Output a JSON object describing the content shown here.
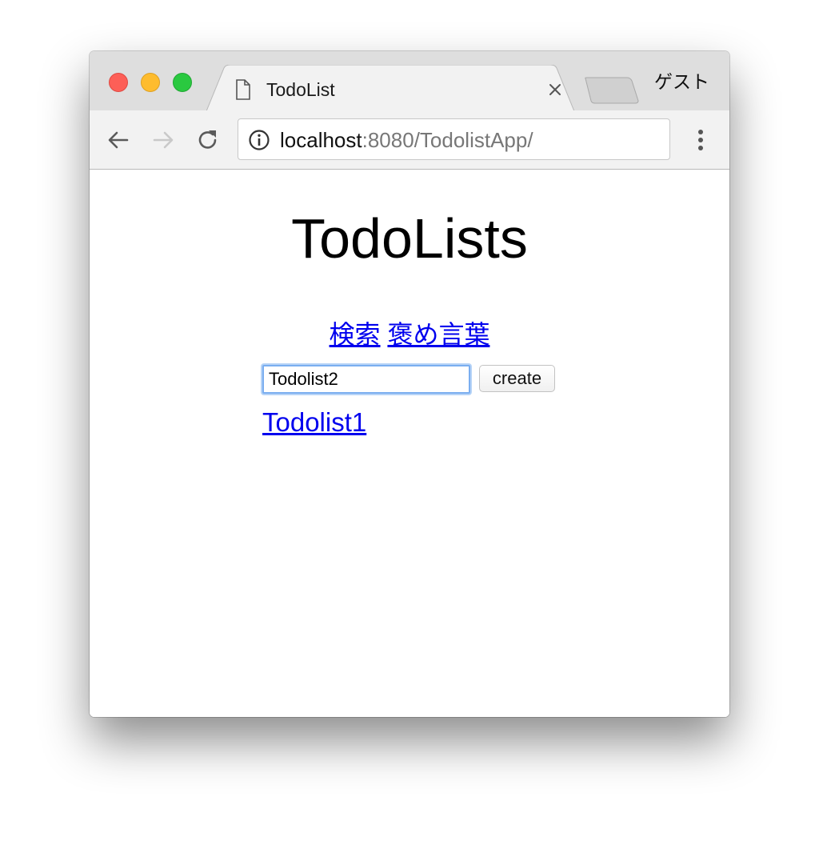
{
  "browser": {
    "tab": {
      "title": "TodoList",
      "icon": "file-icon",
      "close_icon": "close-icon"
    },
    "profile_label": "ゲスト",
    "toolbar": {
      "back_icon": "arrow-left-icon",
      "forward_icon": "arrow-right-icon",
      "reload_icon": "reload-icon",
      "info_icon": "info-icon",
      "menu_icon": "more-vertical-icon"
    },
    "address": {
      "host": "localhost",
      "rest": ":8080/TodolistApp/"
    },
    "colors": {
      "close": "#fd5f57",
      "minimize": "#febc2e",
      "zoom": "#2ac940",
      "link": "#0000ee",
      "focus_ring": "#7aaef0"
    }
  },
  "page": {
    "title": "TodoLists",
    "nav_links": [
      "検索",
      "褒め言葉"
    ],
    "form": {
      "input_value": "Todolist2",
      "button_label": "create"
    },
    "todo_lists": [
      "Todolist1"
    ]
  }
}
